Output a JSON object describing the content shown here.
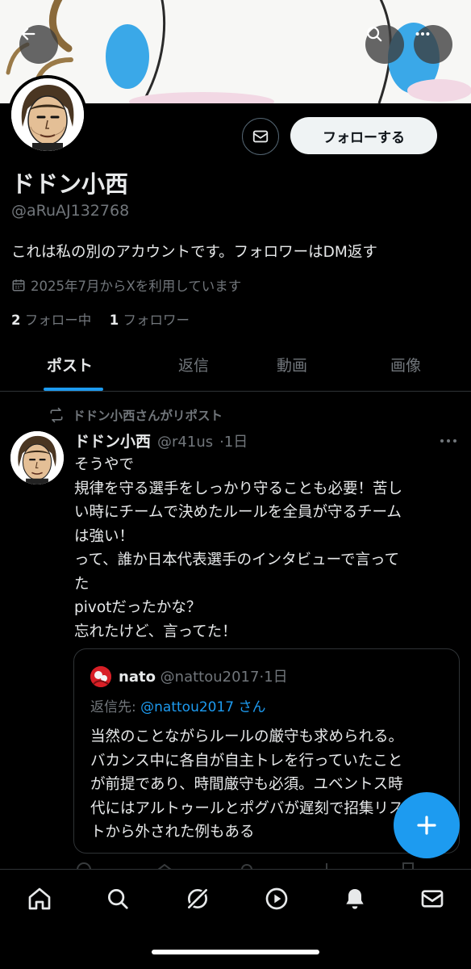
{
  "header": {
    "back_icon": "arrow-left-icon",
    "search_icon": "search-icon",
    "more_icon": "more-horizontal-icon"
  },
  "profile": {
    "name": "ドドン小西",
    "handle": "@aRuAJ132768",
    "bio": "これは私の別のアカウントです。フォロワーはDM返す",
    "joined": "2025年7月からXを利用しています",
    "following_count": "2",
    "following_label": "フォロー中",
    "followers_count": "1",
    "followers_label": "フォロワー",
    "follow_button": "フォローする",
    "dm_icon": "mail-icon"
  },
  "tabs": [
    {
      "label": "ポスト",
      "active": true
    },
    {
      "label": "返信",
      "active": false
    },
    {
      "label": "動画",
      "active": false
    },
    {
      "label": "画像",
      "active": false
    }
  ],
  "post": {
    "repost_label": "ドドン小西さんがリポスト",
    "author_name": "ドドン小西",
    "author_handle": "@r41us",
    "time": "1日",
    "lines": [
      "そうやで",
      "規律を守る選手をしっかり守ることも必要！苦し",
      "い時にチームで決めたルールを全員が守るチーム",
      "は強い！",
      "って、誰か日本代表選手のインタビューで言って",
      "た",
      "pivotだったかな？",
      "忘れたけど、言ってた！"
    ],
    "quote": {
      "author_name": "nato",
      "author_handle": "@nattou2017",
      "time": "1日",
      "reply_prefix": "返信先:",
      "reply_to": "@nattou2017 さん",
      "lines": [
        "当然のことながらルールの厳守も求められる。",
        "バカンス中に各自が自主トレを行っていたこと",
        "が前提であり、時間厳守も必須。ユベントス時",
        "代にはアルトゥールとポグバが遅刻で招集リス",
        "トから外された例もある"
      ]
    }
  },
  "fab": {
    "icon": "plus-icon"
  },
  "bottom_nav": [
    "home-icon",
    "search-icon",
    "grok-icon",
    "video-icon",
    "notifications-icon",
    "messages-icon"
  ],
  "colors": {
    "accent": "#1d9bf0",
    "background": "#000000",
    "secondary_text": "#71767b"
  }
}
